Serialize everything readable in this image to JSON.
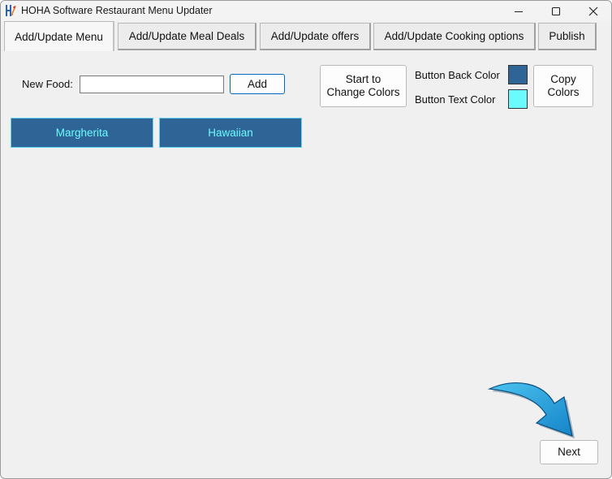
{
  "window": {
    "title": "HOHA Software Restaurant Menu Updater"
  },
  "tabs": [
    {
      "label": "Add/Update Menu",
      "active": true
    },
    {
      "label": "Add/Update Meal Deals",
      "active": false
    },
    {
      "label": "Add/Update offers",
      "active": false
    },
    {
      "label": "Add/Update Cooking options",
      "active": false
    },
    {
      "label": "Publish",
      "active": false
    }
  ],
  "new_food": {
    "label": "New Food:",
    "value": "",
    "add_label": "Add"
  },
  "colors": {
    "start_change_label": "Start to Change Colors",
    "back_color_label": "Button Back Color",
    "text_color_label": "Button Text Color",
    "copy_label": "Copy Colors",
    "back_color": "#2f6496",
    "text_color": "#6afbff"
  },
  "foods": [
    {
      "label": "Margherita"
    },
    {
      "label": "Hawaiian"
    }
  ],
  "footer": {
    "next_label": "Next"
  },
  "arrow": {
    "color": "#1a9ad6"
  }
}
